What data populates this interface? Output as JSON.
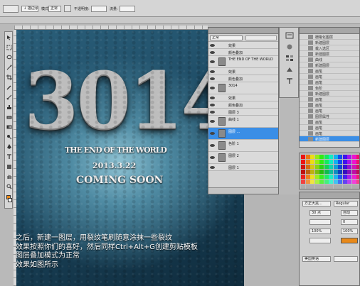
{
  "toolbar": {
    "items": [
      {
        "label": "↓ 描边涂抹",
        "kind": "select"
      },
      {
        "label": "模式:",
        "kind": "label"
      },
      {
        "label": "正常",
        "kind": "select"
      },
      {
        "label": "不透明度:",
        "kind": "label"
      },
      {
        "label": "流量:",
        "kind": "label"
      }
    ]
  },
  "canvas": {
    "year": "3014",
    "line1": "THE END OF THE WORLD",
    "line2": "2013.3.22",
    "line3": "COMING SOON"
  },
  "caption": {
    "lines": [
      "之后，新建一图层，用裂纹笔刷随意涂抹一些裂纹",
      "效果按照你们的喜好，然后同样Ctrl+Alt+G创建剪贴模板",
      "图层叠加模式为正常",
      "效果如图所示"
    ]
  },
  "layers": {
    "blend_mode": "正常",
    "rows": [
      {
        "name": "效果",
        "selected": false,
        "tall": false
      },
      {
        "name": "颜色叠加",
        "selected": false,
        "tall": false
      },
      {
        "name": "THE END OF THE WORLD",
        "selected": false,
        "tall": true
      },
      {
        "name": "效果",
        "selected": false,
        "tall": false
      },
      {
        "name": "颜色叠加",
        "selected": false,
        "tall": false
      },
      {
        "name": "3014",
        "selected": false,
        "tall": true
      },
      {
        "name": "效果",
        "selected": false,
        "tall": false
      },
      {
        "name": "颜色叠加",
        "selected": false,
        "tall": false
      },
      {
        "name": "图层 3",
        "selected": false,
        "tall": false
      },
      {
        "name": "曲线 1",
        "selected": false,
        "tall": true
      },
      {
        "name": "图层 ...",
        "selected": true,
        "tall": true
      },
      {
        "name": "色阶 1",
        "selected": false,
        "tall": true
      },
      {
        "name": "图层 2",
        "selected": false,
        "tall": true
      },
      {
        "name": "图层 1",
        "selected": false,
        "tall": false
      }
    ]
  },
  "history": {
    "rows": [
      {
        "label": "栅格化图层",
        "selected": false
      },
      {
        "label": "新建图层",
        "selected": false
      },
      {
        "label": "载入选区",
        "selected": false
      },
      {
        "label": "新建图层",
        "selected": false
      },
      {
        "label": "曲线",
        "selected": false
      },
      {
        "label": "新建图层",
        "selected": false
      },
      {
        "label": "画笔",
        "selected": false
      },
      {
        "label": "画笔",
        "selected": false
      },
      {
        "label": "画笔",
        "selected": false
      },
      {
        "label": "色阶",
        "selected": false
      },
      {
        "label": "新建图层",
        "selected": false
      },
      {
        "label": "画笔",
        "selected": false
      },
      {
        "label": "画笔",
        "selected": false
      },
      {
        "label": "画笔",
        "selected": false
      },
      {
        "label": "图层属性",
        "selected": false
      },
      {
        "label": "画笔",
        "selected": false
      },
      {
        "label": "画笔",
        "selected": false
      },
      {
        "label": "画笔",
        "selected": false
      },
      {
        "label": "新建图层",
        "selected": true
      }
    ]
  },
  "character": {
    "font": "方正大黑...",
    "style": "Regular",
    "size": "30 点",
    "leading": "自动",
    "tracking": "0",
    "scale_v": "100%",
    "scale_h": "100%",
    "lang": "美国英语"
  },
  "colors": {
    "foreground": "#e8891a",
    "selection": "#3a8ee6"
  },
  "icons": [
    "move-icon",
    "marquee-icon",
    "lasso-icon",
    "magic-wand-icon",
    "crop-icon",
    "eyedropper-icon",
    "brush-icon",
    "stamp-icon",
    "eraser-icon",
    "gradient-icon",
    "dodge-icon",
    "pen-icon",
    "type-icon",
    "shape-icon",
    "hand-icon",
    "zoom-icon"
  ]
}
